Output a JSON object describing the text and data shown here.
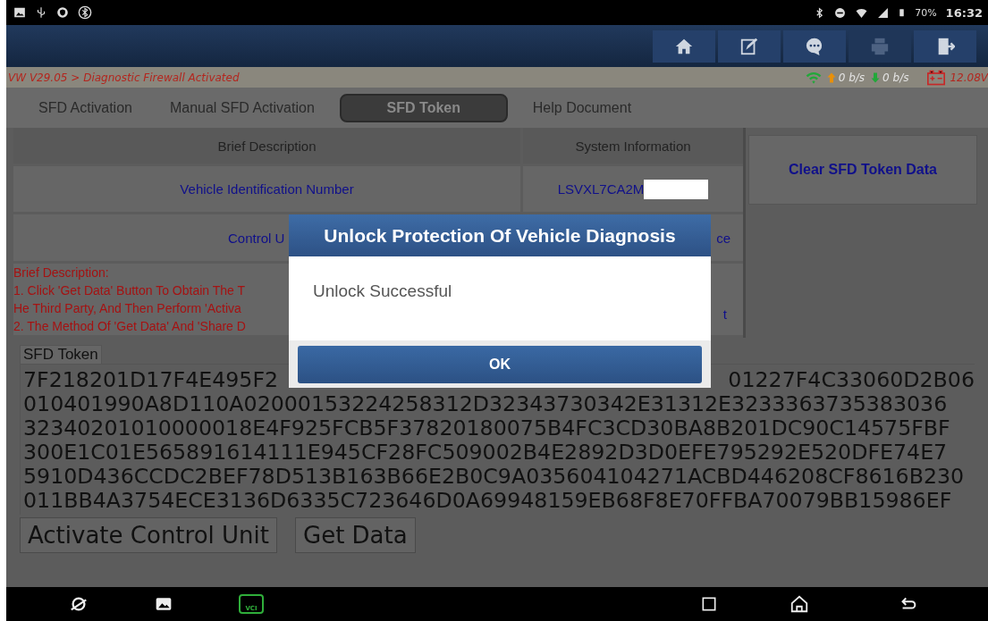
{
  "status_bar": {
    "battery": "70%",
    "time": "16:32"
  },
  "toolbar": {
    "buttons": [
      {
        "kind": "home",
        "disabled": false
      },
      {
        "kind": "edit",
        "disabled": false
      },
      {
        "kind": "chat",
        "disabled": false
      },
      {
        "kind": "print",
        "disabled": true
      },
      {
        "kind": "exit",
        "disabled": false
      }
    ]
  },
  "breadcrumb": {
    "path": "VW V29.05 > Diagnostic Firewall Activated",
    "upload": "0 b/s",
    "download": "0 b/s",
    "voltage": "12.08V"
  },
  "tabs": [
    {
      "label": "SFD Activation",
      "selected": false
    },
    {
      "label": "Manual SFD Activation",
      "selected": false
    },
    {
      "label": "SFD Token",
      "selected": true
    },
    {
      "label": "Help Document",
      "selected": false
    }
  ],
  "table": {
    "columns": [
      "Brief Description",
      "System Information"
    ],
    "rows": [
      {
        "kind": "vin",
        "column_1": "Vehicle Identification Number",
        "column_2": "LSVXL7CA2M"
      },
      {
        "kind": "unit",
        "column_1": "Control U",
        "column_2": "ce"
      },
      {
        "kind": "note",
        "column_1_lines": [
          "Brief Description:",
          "1. Click 'Get Data' Button To Obtain The T",
          "He Third Party, And Then Perform 'Activa",
          "2. The Method Of 'Get Data' And 'Share D"
        ],
        "column_2": "t"
      }
    ]
  },
  "side_panel": {
    "button": "Clear SFD Token Data"
  },
  "token": {
    "label": "SFD Token",
    "first_line": [
      "7F218201D17F4E495F2",
      "01227F4C33060D2B06"
    ],
    "lines": [
      "010401990A8D110A02000153224258312D32343730342E31312E3233363735383036",
      "32340201010000018E4F925FCB5F37820180075B4FC3CD30BA8B201DC90C14575FBF",
      "300E1C01E565891614111E945CF28FC509002B4E2892D3D0EFE795292E520DFE74E7",
      "5910D436CCDC2BEF78D513B163B66E2B0C9A035604104271ACBD446208CF8616B230",
      "011BB4A3754ECE3136D6335C723646D0A69948159EB68F8E70FFBA70079BB15986EF"
    ],
    "buttons": [
      "Activate Control Unit",
      "Get Data"
    ]
  },
  "nav_bar": {
    "vci_label": "VCI"
  },
  "dialog": {
    "title": "Unlock Protection Of Vehicle Diagnosis",
    "message": "Unlock Successful",
    "button": "OK"
  }
}
